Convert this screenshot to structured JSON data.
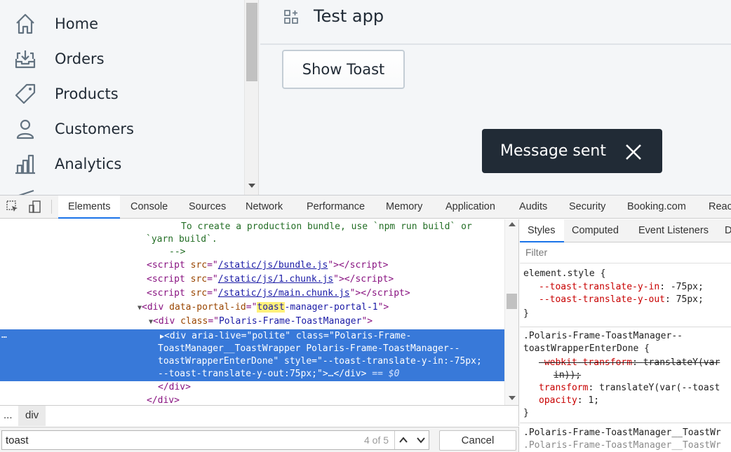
{
  "sidebar": {
    "items": [
      {
        "label": "Home",
        "icon": "home-icon"
      },
      {
        "label": "Orders",
        "icon": "orders-icon"
      },
      {
        "label": "Products",
        "icon": "tag-icon"
      },
      {
        "label": "Customers",
        "icon": "person-icon"
      },
      {
        "label": "Analytics",
        "icon": "bar-chart-icon"
      }
    ]
  },
  "topbar": {
    "title": "Test app",
    "icon": "apps-icon"
  },
  "main": {
    "show_toast_label": "Show Toast"
  },
  "toast": {
    "message": "Message sent",
    "close_icon": "close-icon"
  },
  "devtools": {
    "tabs": [
      "Elements",
      "Console",
      "Sources",
      "Network",
      "Performance",
      "Memory",
      "Application",
      "Audits",
      "Security",
      "Booking.com",
      "Reac"
    ],
    "active_tab": "Elements",
    "code": {
      "l1": "To create a production bundle, use `npm run build` or",
      "l2": "`yarn build`.",
      "l3": "-->",
      "script_src_1": "/static/js/bundle.js",
      "script_src_2": "/static/js/1.chunk.js",
      "script_src_3": "/static/js/main.chunk.js",
      "portal_id_pre": "",
      "portal_id_match": "toast",
      "portal_id_post": "-manager-portal-1",
      "toast_manager_class": "Polaris-Frame-ToastManager",
      "sel_l1_pre": "<div ",
      "sel_l1_attr1": "aria-live",
      "sel_l1_val1": "\"polite\"",
      "sel_l1_attr2": "class",
      "sel_l1_val2a": "\"Polaris-Frame-",
      "sel_l2": "ToastManager__ToastWrapper Polaris-Frame-ToastManager--",
      "sel_l3a": "toastWrapperEnterDone\"",
      "sel_l3_attr": "style",
      "sel_l3_val": "\"--toast-translate-y-in:-75px;",
      "sel_l4_val": "--toast-translate-y-out:75px;\"",
      "sel_l4_tail": ">…</div>",
      "sel_marker": "== $0",
      "close_div": "</div>",
      "close_div2": "</div>"
    },
    "breadcrumb": {
      "ellipsis": "...",
      "current": "div"
    },
    "search": {
      "value": "toast",
      "match_count": "4 of 5",
      "cancel_label": "Cancel"
    },
    "styles": {
      "tabs": [
        "Styles",
        "Computed",
        "Event Listeners",
        "D"
      ],
      "active_tab": "Styles",
      "filter_placeholder": "Filter",
      "element_style_selector": "element.style {",
      "es_p1": "--toast-translate-y-in",
      "es_v1": "-75px;",
      "es_p2": "--toast-translate-y-out",
      "es_v2": "75px;",
      "rule2_sel_1": ".Polaris-Frame-ToastManager--",
      "rule2_sel_2": "toastWrapperEnterDone {",
      "r2_p1": "-webkit-transform",
      "r2_v1a": "translateY(var",
      "r2_v1b": "in));",
      "r2_p2": "transform",
      "r2_v2": "translateY(var(--toast",
      "r2_p3": "opacity",
      "r2_v3": "1;",
      "rule3_sel_1": ".Polaris-Frame-ToastManager__ToastWr",
      "rule3_sel_2": ".Polaris-Frame-ToastManager__ToastWr",
      "close_brace": "}"
    }
  },
  "colors": {
    "accent": "#1a73e8",
    "selected_row": "#3879d9",
    "toast_bg": "#212b36",
    "app_bg": "#f4f6f8"
  }
}
